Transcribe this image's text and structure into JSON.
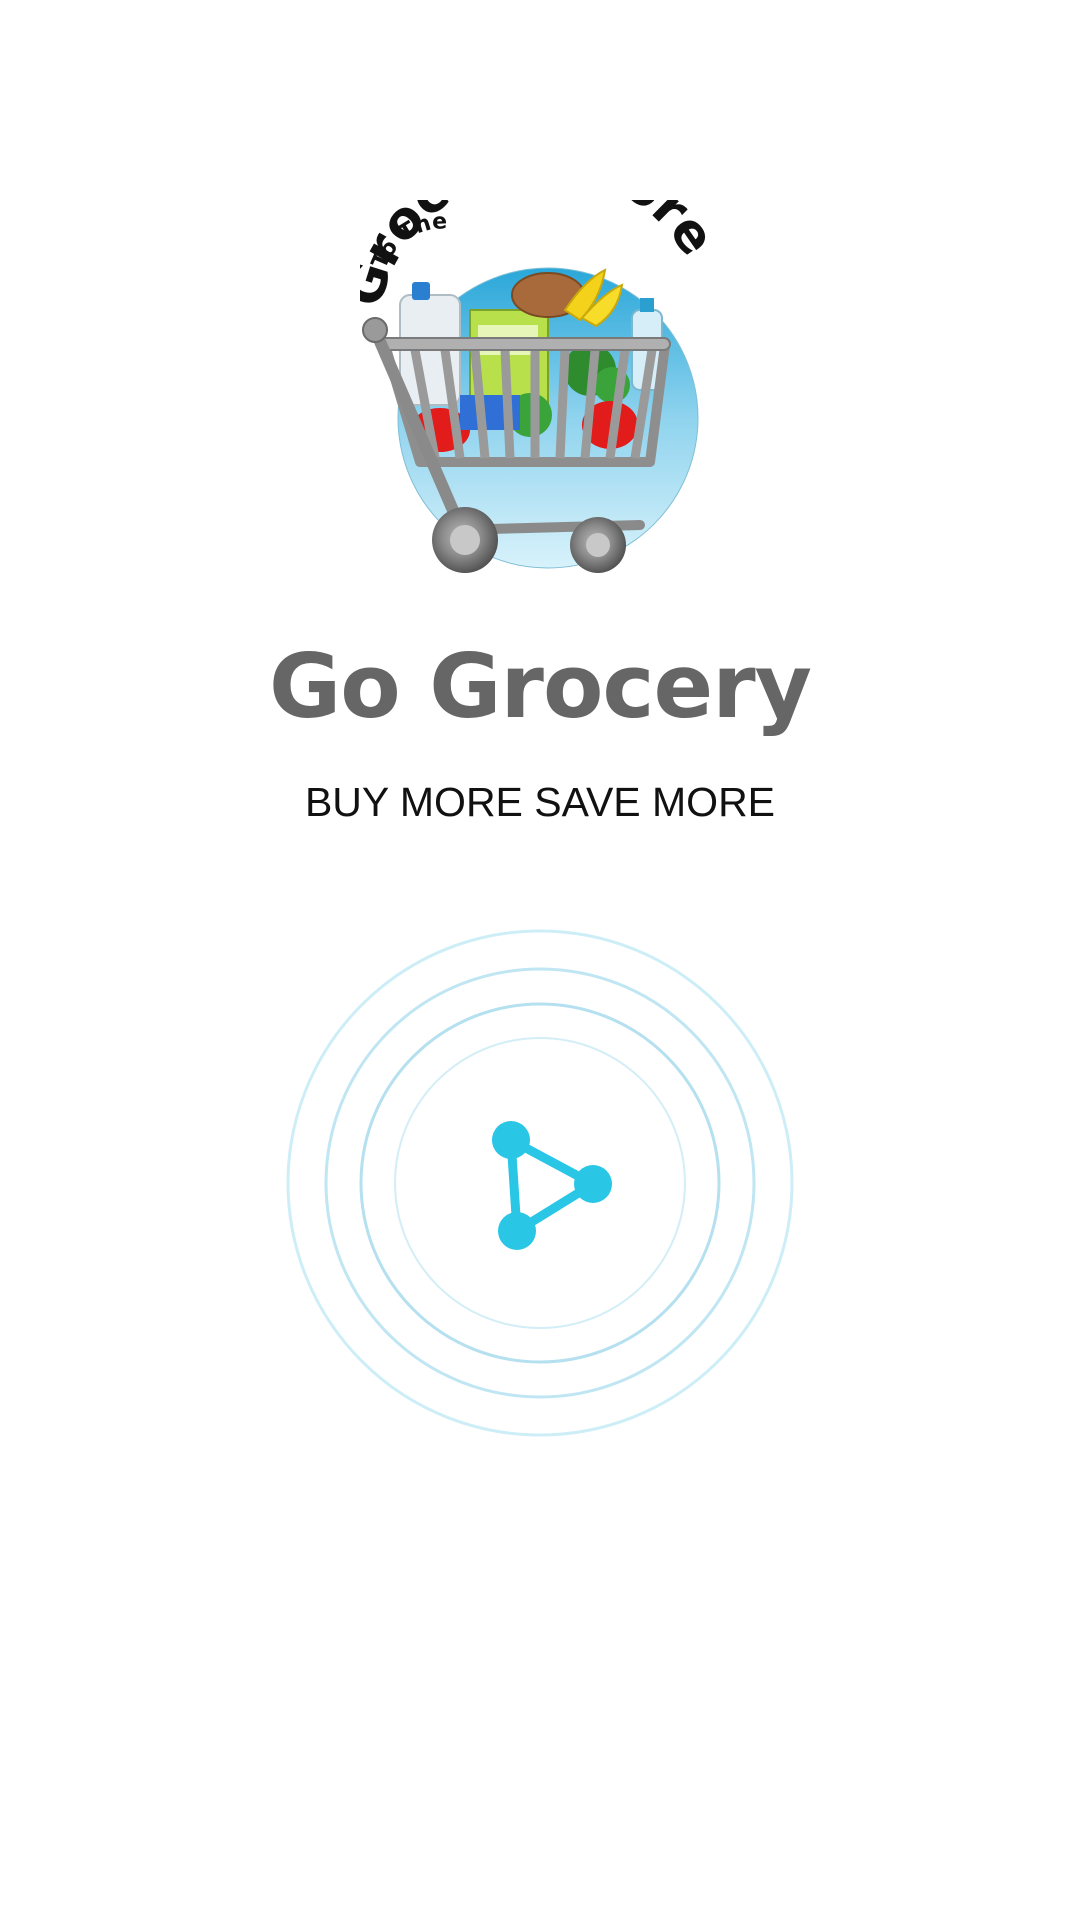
{
  "splash": {
    "logo": {
      "top_text": "To The",
      "main_text": "Grocery Store",
      "icon": "shopping-cart-icon"
    },
    "app_title": "Go Grocery",
    "tagline": "BUY MORE SAVE MORE",
    "loader": {
      "icon": "share-nodes-icon",
      "accent_color": "#29c6e6",
      "ring_color": "#bfe6f2"
    }
  }
}
